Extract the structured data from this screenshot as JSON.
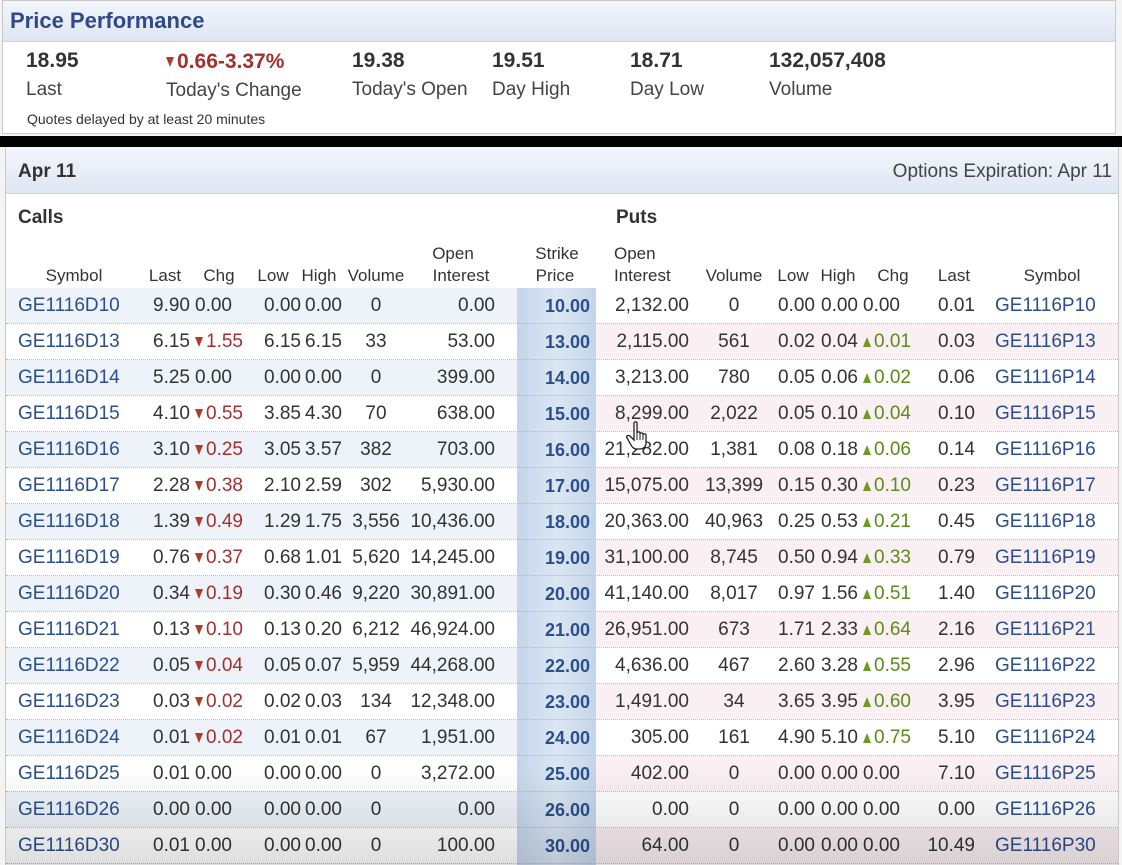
{
  "price_performance": {
    "title": "Price Performance",
    "last": "18.95",
    "last_label": "Last",
    "change": "0.66-3.37%",
    "change_label": "Today's Change",
    "open": "19.38",
    "open_label": "Today's Open",
    "high": "19.51",
    "high_label": "Day High",
    "low": "18.71",
    "low_label": "Day Low",
    "volume": "132,057,408",
    "volume_label": "Volume",
    "note": "Quotes delayed by at least 20 minutes"
  },
  "options": {
    "month": "Apr 11",
    "expiration": "Options Expiration: Apr 11",
    "calls_label": "Calls",
    "puts_label": "Puts",
    "headers": {
      "symbol": "Symbol",
      "last": "Last",
      "chg": "Chg",
      "low": "Low",
      "high": "High",
      "volume": "Volume",
      "oi_top": "Open",
      "oi_bottom": "Interest",
      "strike_top": "Strike",
      "strike_bottom": "Price"
    },
    "rows": [
      {
        "cs": "GE1116D10",
        "cl": "9.90",
        "cc": "0.00",
        "cd": "",
        "clo": "0.00",
        "chi": "0.00",
        "cv": "0",
        "coi": "0.00",
        "k": "10.00",
        "poi": "2,132.00",
        "pv": "0",
        "plo": "0.00",
        "phi": "0.00",
        "pc": "0.00",
        "pd": "",
        "pl": "0.01",
        "ps": "GE1116P10"
      },
      {
        "cs": "GE1116D13",
        "cl": "6.15",
        "cc": "1.55",
        "cd": "down",
        "clo": "6.15",
        "chi": "6.15",
        "cv": "33",
        "coi": "53.00",
        "k": "13.00",
        "poi": "2,115.00",
        "pv": "561",
        "plo": "0.02",
        "phi": "0.04",
        "pc": "0.01",
        "pd": "up",
        "pl": "0.03",
        "ps": "GE1116P13"
      },
      {
        "cs": "GE1116D14",
        "cl": "5.25",
        "cc": "0.00",
        "cd": "",
        "clo": "0.00",
        "chi": "0.00",
        "cv": "0",
        "coi": "399.00",
        "k": "14.00",
        "poi": "3,213.00",
        "pv": "780",
        "plo": "0.05",
        "phi": "0.06",
        "pc": "0.02",
        "pd": "up",
        "pl": "0.06",
        "ps": "GE1116P14"
      },
      {
        "cs": "GE1116D15",
        "cl": "4.10",
        "cc": "0.55",
        "cd": "down",
        "clo": "3.85",
        "chi": "4.30",
        "cv": "70",
        "coi": "638.00",
        "k": "15.00",
        "poi": "8,299.00",
        "pv": "2,022",
        "plo": "0.05",
        "phi": "0.10",
        "pc": "0.04",
        "pd": "up",
        "pl": "0.10",
        "ps": "GE1116P15"
      },
      {
        "cs": "GE1116D16",
        "cl": "3.10",
        "cc": "0.25",
        "cd": "down",
        "clo": "3.05",
        "chi": "3.57",
        "cv": "382",
        "coi": "703.00",
        "k": "16.00",
        "poi": "21,282.00",
        "pv": "1,381",
        "plo": "0.08",
        "phi": "0.18",
        "pc": "0.06",
        "pd": "up",
        "pl": "0.14",
        "ps": "GE1116P16"
      },
      {
        "cs": "GE1116D17",
        "cl": "2.28",
        "cc": "0.38",
        "cd": "down",
        "clo": "2.10",
        "chi": "2.59",
        "cv": "302",
        "coi": "5,930.00",
        "k": "17.00",
        "poi": "15,075.00",
        "pv": "13,399",
        "plo": "0.15",
        "phi": "0.30",
        "pc": "0.10",
        "pd": "up",
        "pl": "0.23",
        "ps": "GE1116P17"
      },
      {
        "cs": "GE1116D18",
        "cl": "1.39",
        "cc": "0.49",
        "cd": "down",
        "clo": "1.29",
        "chi": "1.75",
        "cv": "3,556",
        "coi": "10,436.00",
        "k": "18.00",
        "poi": "20,363.00",
        "pv": "40,963",
        "plo": "0.25",
        "phi": "0.53",
        "pc": "0.21",
        "pd": "up",
        "pl": "0.45",
        "ps": "GE1116P18"
      },
      {
        "cs": "GE1116D19",
        "cl": "0.76",
        "cc": "0.37",
        "cd": "down",
        "clo": "0.68",
        "chi": "1.01",
        "cv": "5,620",
        "coi": "14,245.00",
        "k": "19.00",
        "poi": "31,100.00",
        "pv": "8,745",
        "plo": "0.50",
        "phi": "0.94",
        "pc": "0.33",
        "pd": "up",
        "pl": "0.79",
        "ps": "GE1116P19"
      },
      {
        "cs": "GE1116D20",
        "cl": "0.34",
        "cc": "0.19",
        "cd": "down",
        "clo": "0.30",
        "chi": "0.46",
        "cv": "9,220",
        "coi": "30,891.00",
        "k": "20.00",
        "poi": "41,140.00",
        "pv": "8,017",
        "plo": "0.97",
        "phi": "1.56",
        "pc": "0.51",
        "pd": "up",
        "pl": "1.40",
        "ps": "GE1116P20"
      },
      {
        "cs": "GE1116D21",
        "cl": "0.13",
        "cc": "0.10",
        "cd": "down",
        "clo": "0.13",
        "chi": "0.20",
        "cv": "6,212",
        "coi": "46,924.00",
        "k": "21.00",
        "poi": "26,951.00",
        "pv": "673",
        "plo": "1.71",
        "phi": "2.33",
        "pc": "0.64",
        "pd": "up",
        "pl": "2.16",
        "ps": "GE1116P21"
      },
      {
        "cs": "GE1116D22",
        "cl": "0.05",
        "cc": "0.04",
        "cd": "down",
        "clo": "0.05",
        "chi": "0.07",
        "cv": "5,959",
        "coi": "44,268.00",
        "k": "22.00",
        "poi": "4,636.00",
        "pv": "467",
        "plo": "2.60",
        "phi": "3.28",
        "pc": "0.55",
        "pd": "up",
        "pl": "2.96",
        "ps": "GE1116P22"
      },
      {
        "cs": "GE1116D23",
        "cl": "0.03",
        "cc": "0.02",
        "cd": "down",
        "clo": "0.02",
        "chi": "0.03",
        "cv": "134",
        "coi": "12,348.00",
        "k": "23.00",
        "poi": "1,491.00",
        "pv": "34",
        "plo": "3.65",
        "phi": "3.95",
        "pc": "0.60",
        "pd": "up",
        "pl": "3.95",
        "ps": "GE1116P23"
      },
      {
        "cs": "GE1116D24",
        "cl": "0.01",
        "cc": "0.02",
        "cd": "down",
        "clo": "0.01",
        "chi": "0.01",
        "cv": "67",
        "coi": "1,951.00",
        "k": "24.00",
        "poi": "305.00",
        "pv": "161",
        "plo": "4.90",
        "phi": "5.10",
        "pc": "0.75",
        "pd": "up",
        "pl": "5.10",
        "ps": "GE1116P24"
      },
      {
        "cs": "GE1116D25",
        "cl": "0.01",
        "cc": "0.00",
        "cd": "",
        "clo": "0.00",
        "chi": "0.00",
        "cv": "0",
        "coi": "3,272.00",
        "k": "25.00",
        "poi": "402.00",
        "pv": "0",
        "plo": "0.00",
        "phi": "0.00",
        "pc": "0.00",
        "pd": "",
        "pl": "7.10",
        "ps": "GE1116P25"
      },
      {
        "cs": "GE1116D26",
        "cl": "0.00",
        "cc": "0.00",
        "cd": "",
        "clo": "0.00",
        "chi": "0.00",
        "cv": "0",
        "coi": "0.00",
        "k": "26.00",
        "poi": "0.00",
        "pv": "0",
        "plo": "0.00",
        "phi": "0.00",
        "pc": "0.00",
        "pd": "",
        "pl": "0.00",
        "ps": "GE1116P26"
      },
      {
        "cs": "GE1116D30",
        "cl": "0.01",
        "cc": "0.00",
        "cd": "",
        "clo": "0.00",
        "chi": "0.00",
        "cv": "0",
        "coi": "100.00",
        "k": "30.00",
        "poi": "64.00",
        "pv": "0",
        "plo": "0.00",
        "phi": "0.00",
        "pc": "0.00",
        "pd": "",
        "pl": "10.49",
        "ps": "GE1116P30"
      }
    ]
  },
  "colors": {
    "title_blue": "#2f4a88",
    "link_blue": "#2b4f8a",
    "down_red": "#a33030",
    "up_green": "#5c8a1c"
  },
  "icons": {
    "down_arrow": "arrow-down-icon",
    "up_arrow": "arrow-up-icon",
    "cursor": "hand-pointer-icon"
  }
}
